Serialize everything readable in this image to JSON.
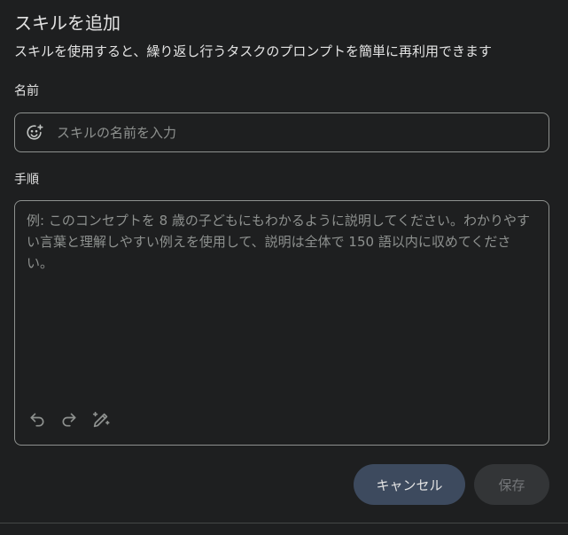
{
  "dialog": {
    "title": "スキルを追加",
    "subtitle": "スキルを使用すると、繰り返し行うタスクのプロンプトを簡単に再利用できます"
  },
  "name_field": {
    "label": "名前",
    "placeholder": "スキルの名前を入力",
    "value": "",
    "icon": "add-emoji-icon"
  },
  "steps_field": {
    "label": "手順",
    "placeholder": "例: このコンセプトを 8 歳の子どもにもわかるように説明してください。わかりやすい言葉と理解しやすい例えを使用して、説明は全体で 150 語以内に収めてください。",
    "value": "",
    "tools": [
      "undo-icon",
      "redo-icon",
      "magic-pen-icon"
    ]
  },
  "actions": {
    "cancel_label": "キャンセル",
    "save_label": "保存",
    "save_enabled": false
  },
  "colors": {
    "background": "#1e1f20",
    "border": "#8e918f",
    "cancel_bg": "#3d4a5e",
    "save_bg": "#333537"
  }
}
